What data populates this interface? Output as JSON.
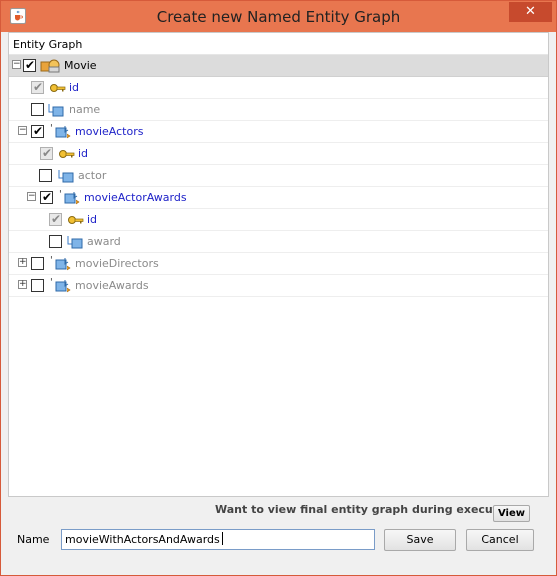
{
  "window": {
    "title": "Create new Named Entity Graph",
    "icon": "java-cup-icon",
    "close_glyph": "✕",
    "accent": "#e8764f"
  },
  "tree": {
    "header": "Entity Graph",
    "rows": [
      {
        "label": "Movie",
        "expander": "−",
        "checked": true,
        "enabled": true,
        "icon": "entity-icon",
        "color": "black"
      },
      {
        "label": "id",
        "expander": "",
        "checked": true,
        "enabled": false,
        "icon": "key-icon",
        "color": "blue"
      },
      {
        "label": "name",
        "expander": "",
        "checked": false,
        "enabled": true,
        "icon": "attribute-icon",
        "color": "gray"
      },
      {
        "label": "movieActors",
        "expander": "−",
        "checked": true,
        "enabled": true,
        "icon": "relationship-icon",
        "color": "blue"
      },
      {
        "label": "id",
        "expander": "",
        "checked": true,
        "enabled": false,
        "icon": "key-icon",
        "color": "blue"
      },
      {
        "label": "actor",
        "expander": "",
        "checked": false,
        "enabled": true,
        "icon": "attribute-icon",
        "color": "gray"
      },
      {
        "label": "movieActorAwards",
        "expander": "−",
        "checked": true,
        "enabled": true,
        "icon": "relationship-icon",
        "color": "blue"
      },
      {
        "label": "id",
        "expander": "",
        "checked": true,
        "enabled": false,
        "icon": "key-icon",
        "color": "blue"
      },
      {
        "label": "award",
        "expander": "",
        "checked": false,
        "enabled": true,
        "icon": "attribute-icon",
        "color": "gray"
      },
      {
        "label": "movieDirectors",
        "expander": "+",
        "checked": false,
        "enabled": true,
        "icon": "relationship-icon",
        "color": "gray"
      },
      {
        "label": "movieAwards",
        "expander": "+",
        "checked": false,
        "enabled": true,
        "icon": "relationship-icon",
        "color": "gray"
      }
    ]
  },
  "footer": {
    "question": "Want to view final entity graph during execution ?",
    "view_label": "View",
    "name_label": "Name",
    "name_value": "movieWithActorsAndAwards",
    "save_label": "Save",
    "cancel_label": "Cancel"
  }
}
